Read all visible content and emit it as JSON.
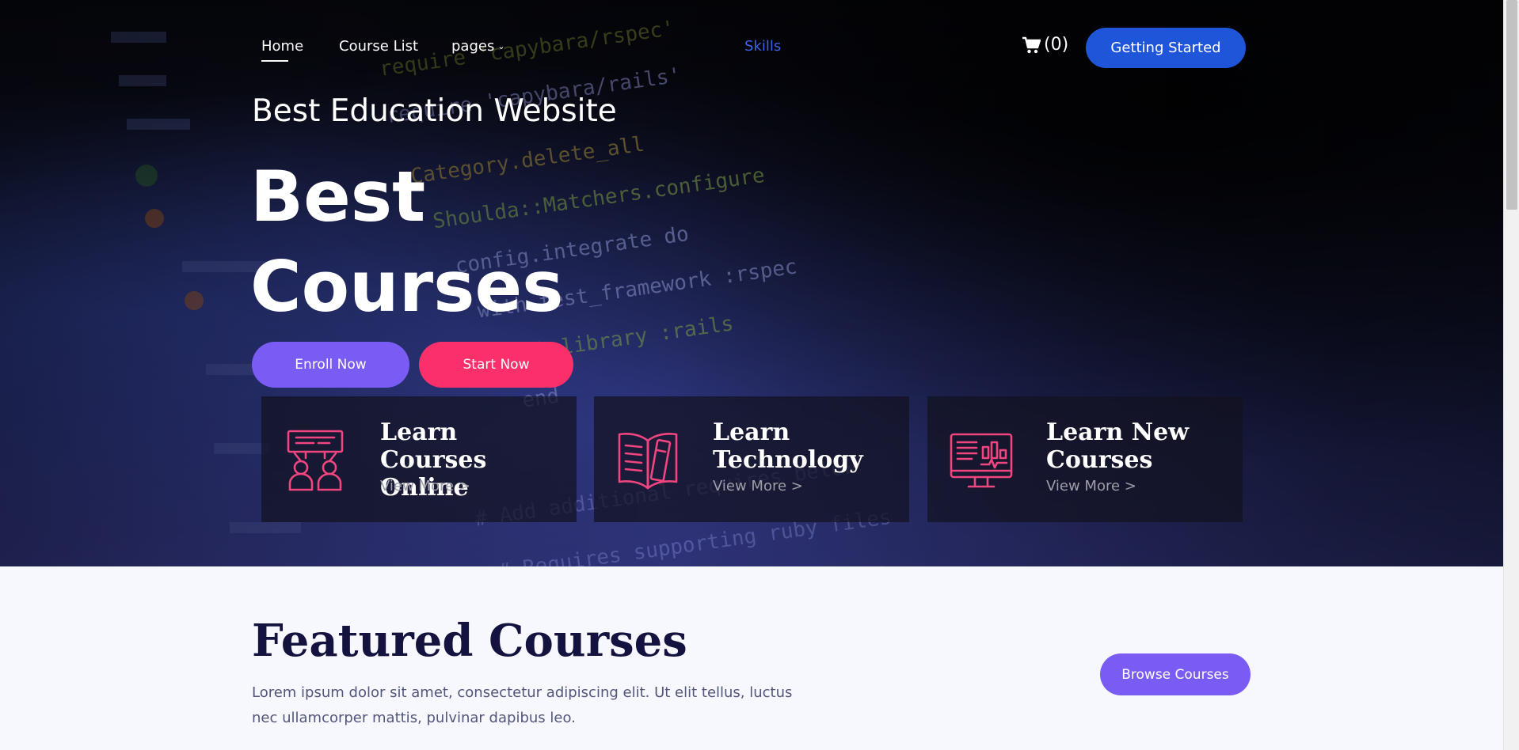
{
  "nav": {
    "home": "Home",
    "course_list": "Course List",
    "pages": "pages",
    "skills": "Skills",
    "cart_count": "(0)",
    "getting_started": "Getting Started"
  },
  "hero": {
    "subtitle": "Best Education Website",
    "title_line1": "Best",
    "title_line2": "Courses",
    "enroll_now": "Enroll Now",
    "start_now": "Start Now"
  },
  "features": [
    {
      "title": "Learn Courses Online",
      "more": "View More >",
      "icon": "teacher-students-icon"
    },
    {
      "title": "Learn Technology",
      "more": "View More >",
      "icon": "open-book-icon"
    },
    {
      "title": "Learn New Courses",
      "more": "View More >",
      "icon": "monitor-analytics-icon"
    }
  ],
  "featured": {
    "title": "Featured Courses",
    "description": "Lorem ipsum dolor sit amet, consectetur adipiscing elit. Ut elit tellus, luctus nec ullamcorper mattis, pulvinar dapibus leo.",
    "browse": "Browse Courses"
  },
  "colors": {
    "primary_blue": "#1f55d8",
    "purple": "#7a5cf5",
    "pink": "#fb2f6a",
    "icon_pink": "#f0457f",
    "skills_link": "#3b63e6",
    "heading_dark": "#14123f"
  }
}
